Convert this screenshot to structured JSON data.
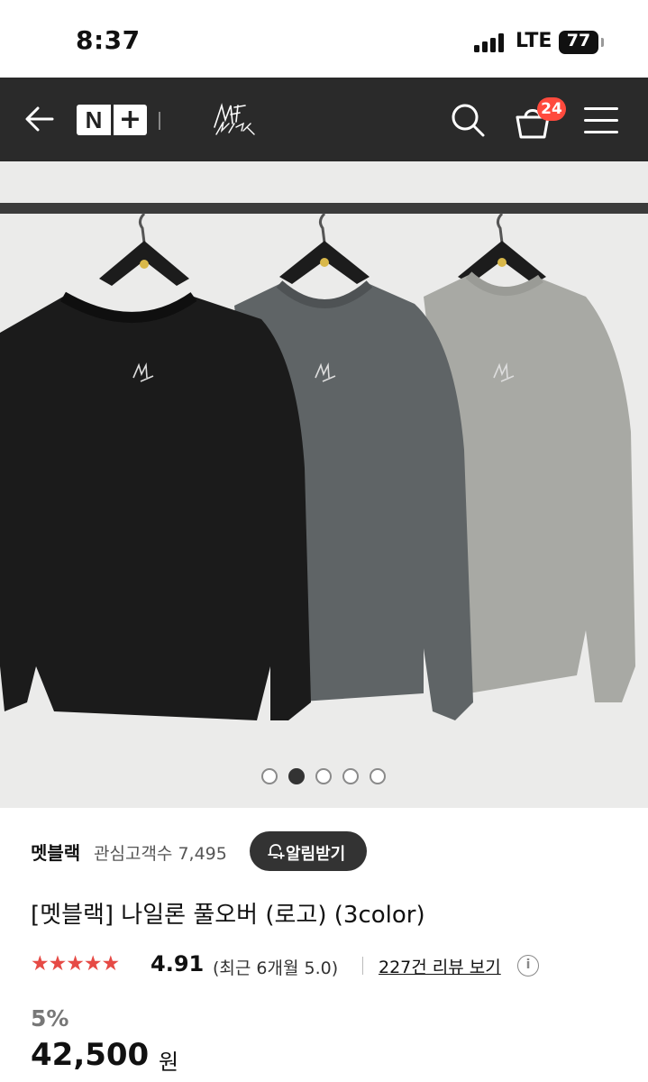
{
  "status": {
    "time": "8:37",
    "network": "LTE",
    "battery": "77"
  },
  "nav": {
    "nplus_n": "N",
    "nplus_plus": "+",
    "cart_count": "24",
    "brand_logo": "MAT BLACK"
  },
  "carousel": {
    "total": 5,
    "active": 2
  },
  "seller": {
    "name": "멧블랙",
    "fans_label": "관심고객수 7,495",
    "alert_label": "알림받기"
  },
  "product": {
    "title": "[멧블랙] 나일론 풀오버 (로고) (3color)",
    "stars": "★★★★★",
    "rating": "4.91",
    "recent": "(최근 6개월 5.0)",
    "review_link": "227건 리뷰 보기",
    "info": "i",
    "discount": "5%",
    "price": "42,500",
    "price_unit": "원"
  },
  "colors": {
    "nav_bg": "#2a2a2a",
    "badge": "#ff4a3d",
    "star": "#e64a45"
  }
}
